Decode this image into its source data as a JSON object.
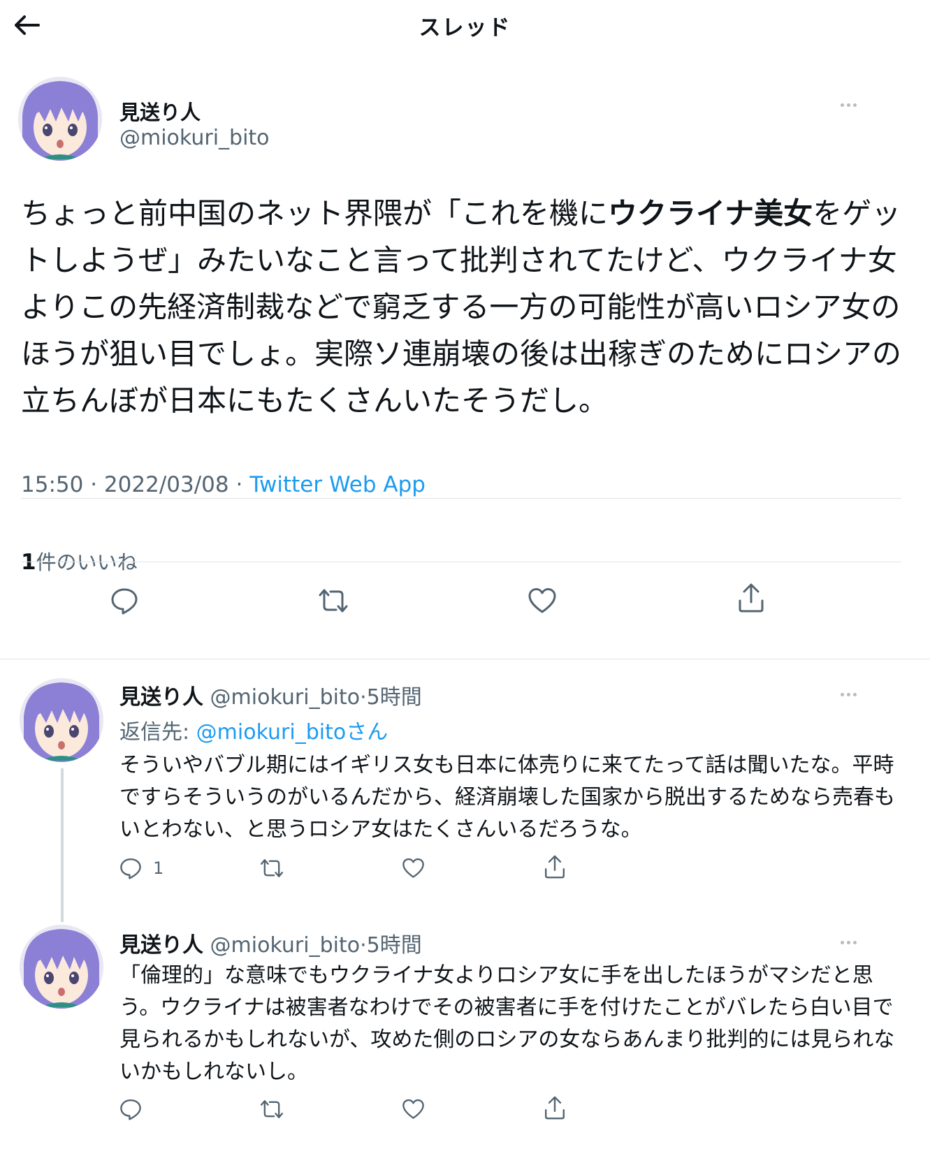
{
  "header": {
    "title": "スレッド"
  },
  "main_tweet": {
    "display_name": "見送り人",
    "handle": "@miokuri_bito",
    "text_part1": "ちょっと前中国のネット界隈が「これを機に",
    "text_bold": "ウクライナ美女",
    "text_part2": "をゲットしようぜ」みたいなこと言って批判されてたけど、ウクライナ女よりこの先経済制裁などで窮乏する一方の可能性が高いロシア女のほうが狙い目でしょ。実際ソ連崩壊の後は出稼ぎのためにロシアの立ちんぼが日本にもたくさんいたそうだし。",
    "time": "15:50",
    "date": "2022/03/08",
    "separator": "·",
    "source": "Twitter Web App",
    "likes_count": "1",
    "likes_label": "件のいいね"
  },
  "replies": [
    {
      "display_name": "見送り人",
      "handle": "@miokuri_bito",
      "separator": "·",
      "time": "5時間",
      "reply_to_label": "返信先: ",
      "reply_to_mention": "@miokuri_bito",
      "reply_to_suffix": "さん",
      "text": "そういやバブル期にはイギリス女も日本に体売りに来てたって話は聞いたな。平時ですらそういうのがいるんだから、経済崩壊した国家から脱出するためなら売春もいとわない、と思うロシア女はたくさんいるだろうな。",
      "reply_count": "1"
    },
    {
      "display_name": "見送り人",
      "handle": "@miokuri_bito",
      "separator": "·",
      "time": "5時間",
      "text": "「倫理的」な意味でもウクライナ女よりロシア女に手を出したほうがマシだと思う。ウクライナは被害者なわけでその被害者に手を付けたことがバレたら白い目で見られるかもしれないが、攻めた側のロシアの女ならあんまり批判的には見られないかもしれないし。"
    }
  ],
  "icons": {
    "back": "arrow-left-icon",
    "more": "more-horizontal-icon",
    "reply": "speech-bubble-icon",
    "retweet": "retweet-icon",
    "like": "heart-icon",
    "share": "share-upload-icon"
  },
  "colors": {
    "accent": "#1d9bf0",
    "secondary_text": "#536471",
    "avatar_hair": "#8b7fd6"
  }
}
